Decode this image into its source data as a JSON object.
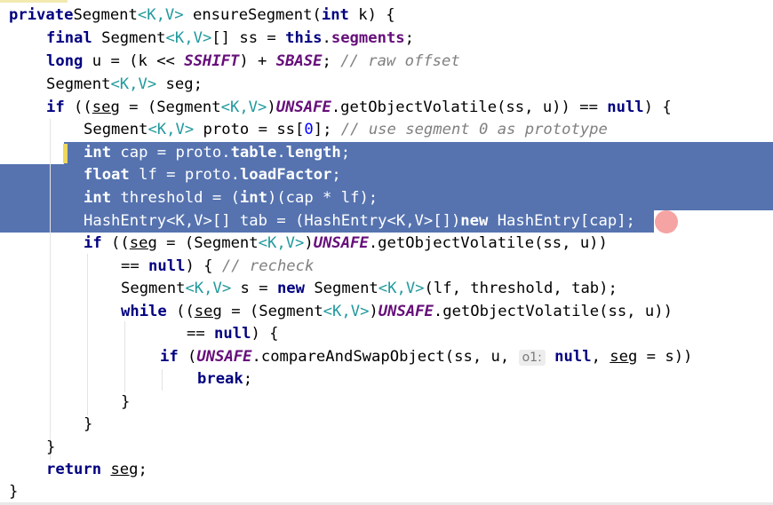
{
  "lines": [
    {
      "segs": [
        [
          "kw",
          "private"
        ],
        [
          "",
          "Segment"
        ],
        [
          "tp",
          "<K,V>"
        ],
        [
          "",
          " ensureSegment("
        ],
        [
          "kw",
          "int"
        ],
        [
          "",
          " k) {"
        ]
      ]
    },
    {
      "segs": [
        [
          "kw",
          "final"
        ],
        [
          "",
          " Segment"
        ],
        [
          "tp",
          "<K,V>"
        ],
        [
          "",
          "[] ss = "
        ],
        [
          "kw",
          "this"
        ],
        [
          "",
          "."
        ],
        [
          "fld",
          "segments"
        ],
        [
          "",
          ";"
        ]
      ]
    },
    {
      "segs": [
        [
          "kw",
          "long"
        ],
        [
          "",
          " u = (k << "
        ],
        [
          "cst",
          "SSHIFT"
        ],
        [
          "",
          ") + "
        ],
        [
          "cst",
          "SBASE"
        ],
        [
          "",
          "; "
        ],
        [
          "cm",
          "// raw offset"
        ]
      ]
    },
    {
      "segs": [
        [
          "",
          "Segment"
        ],
        [
          "tp",
          "<K,V>"
        ],
        [
          "",
          " seg;"
        ]
      ]
    },
    {
      "segs": [
        [
          "kw",
          "if"
        ],
        [
          "",
          " (("
        ],
        [
          "ul",
          "seg"
        ],
        [
          "",
          " = (Segment"
        ],
        [
          "tp",
          "<K,V>"
        ],
        [
          "",
          ")"
        ],
        [
          "cst",
          "UNSAFE"
        ],
        [
          "",
          ".getObjectVolatile(ss, u)) == "
        ],
        [
          "kw",
          "null"
        ],
        [
          "",
          ") {"
        ]
      ]
    },
    {
      "segs": [
        [
          "",
          "Segment"
        ],
        [
          "tp",
          "<K,V>"
        ],
        [
          "",
          " proto = ss["
        ],
        [
          "num",
          "0"
        ],
        [
          "",
          "]; "
        ],
        [
          "cm",
          "// use segment 0 as prototype"
        ]
      ]
    },
    {
      "segs": [
        [
          "kw",
          "int"
        ],
        [
          "",
          " cap = proto."
        ],
        [
          "fld",
          "table"
        ],
        [
          "",
          "."
        ],
        [
          "fld",
          "length"
        ],
        [
          "",
          ";"
        ]
      ]
    },
    {
      "segs": [
        [
          "kw",
          "float"
        ],
        [
          "",
          " lf = proto."
        ],
        [
          "fld",
          "loadFactor"
        ],
        [
          "",
          ";"
        ]
      ]
    },
    {
      "segs": [
        [
          "kw",
          "int"
        ],
        [
          "",
          " threshold = ("
        ],
        [
          "kw",
          "int"
        ],
        [
          "",
          ")(cap * lf);"
        ]
      ]
    },
    {
      "segs": [
        [
          "",
          "HashEntry"
        ],
        [
          "tp",
          "<K,V>"
        ],
        [
          "",
          "[] tab = (HashEntry"
        ],
        [
          "tp",
          "<K,V>"
        ],
        [
          "",
          "[])"
        ],
        [
          "kw",
          "new"
        ],
        [
          "",
          " HashEntry[cap];"
        ]
      ]
    },
    {
      "segs": [
        [
          "kw",
          "if"
        ],
        [
          "",
          " (("
        ],
        [
          "ul",
          "seg"
        ],
        [
          "",
          " = (Segment"
        ],
        [
          "tp",
          "<K,V>"
        ],
        [
          "",
          ")"
        ],
        [
          "cst",
          "UNSAFE"
        ],
        [
          "",
          ".getObjectVolatile(ss, u))"
        ]
      ]
    },
    {
      "segs": [
        [
          "",
          "== "
        ],
        [
          "kw",
          "null"
        ],
        [
          "",
          ") { "
        ],
        [
          "cm",
          "// recheck"
        ]
      ]
    },
    {
      "segs": [
        [
          "",
          "Segment"
        ],
        [
          "tp",
          "<K,V>"
        ],
        [
          "",
          " s = "
        ],
        [
          "kw",
          "new"
        ],
        [
          "",
          " Segment"
        ],
        [
          "tp",
          "<K,V>"
        ],
        [
          "",
          "(lf, threshold, tab);"
        ]
      ]
    },
    {
      "segs": [
        [
          "kw",
          "while"
        ],
        [
          "",
          " (("
        ],
        [
          "ul",
          "seg"
        ],
        [
          "",
          " = (Segment"
        ],
        [
          "tp",
          "<K,V>"
        ],
        [
          "",
          ")"
        ],
        [
          "cst",
          "UNSAFE"
        ],
        [
          "",
          ".getObjectVolatile(ss, u))"
        ]
      ]
    },
    {
      "segs": [
        [
          "",
          "== "
        ],
        [
          "kw",
          "null"
        ],
        [
          "",
          ") {"
        ]
      ]
    },
    {
      "segs": [
        [
          "kw",
          "if"
        ],
        [
          "",
          " ("
        ],
        [
          "cst",
          "UNSAFE"
        ],
        [
          "",
          ".compareAndSwapObject(ss, u, "
        ],
        [
          "hint",
          "o1:"
        ],
        [
          "",
          " "
        ],
        [
          "kw",
          "null"
        ],
        [
          "",
          ", "
        ],
        [
          "ul",
          "seg"
        ],
        [
          "",
          " = s))"
        ]
      ]
    },
    {
      "segs": [
        [
          "kw",
          "break"
        ],
        [
          "",
          ";"
        ]
      ]
    },
    {
      "segs": [
        [
          "",
          "}"
        ]
      ]
    },
    {
      "segs": [
        [
          "",
          "}"
        ]
      ]
    },
    {
      "segs": [
        [
          "",
          "}"
        ]
      ]
    },
    {
      "segs": [
        [
          "kw",
          "return"
        ],
        [
          "",
          " "
        ],
        [
          "ul",
          "seg"
        ],
        [
          "",
          ";"
        ]
      ]
    },
    {
      "segs": [
        [
          "",
          "}"
        ]
      ]
    }
  ],
  "colors": {
    "keyword": "#000080",
    "field": "#660e7a",
    "type_param": "#20999d",
    "comment": "#808080",
    "number": "#0000ff",
    "selection": "#5673b0",
    "breakpoint": "#f5a3a3",
    "background": "#ffffff"
  },
  "icons": {
    "breakpoint": "breakpoint-icon"
  }
}
